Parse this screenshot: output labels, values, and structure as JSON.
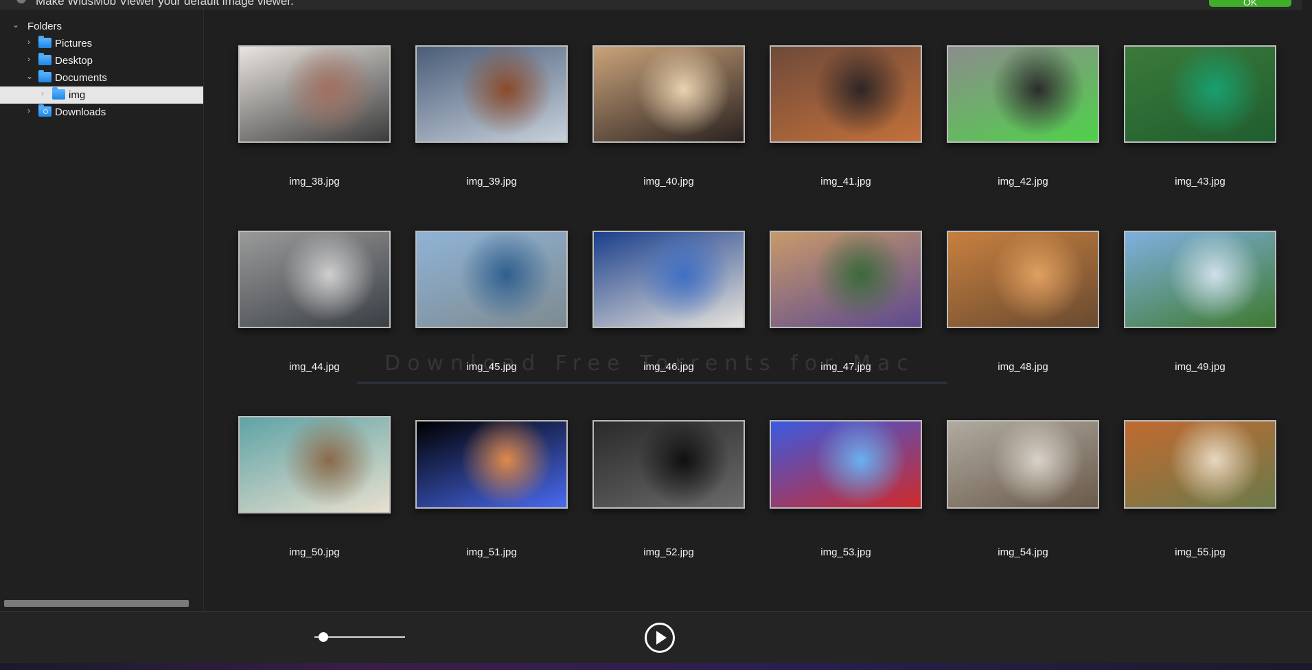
{
  "notification": {
    "message": "Make WidsMob Viewer your default image viewer.",
    "ok_label": "OK"
  },
  "sidebar": {
    "root_label": "Folders",
    "items": [
      {
        "label": "Pictures",
        "icon": "folder-icon"
      },
      {
        "label": "Desktop",
        "icon": "folder-icon"
      },
      {
        "label": "Documents",
        "icon": "folder-icon",
        "expanded": true
      },
      {
        "label": "img",
        "icon": "folder-icon",
        "selected": true
      },
      {
        "label": "Downloads",
        "icon": "downloads-folder-icon"
      }
    ]
  },
  "thumbnails": [
    {
      "name": "img_38.jpg",
      "colors": [
        "#e8e4df",
        "#3b3b3b",
        "#a07060"
      ]
    },
    {
      "name": "img_39.jpg",
      "colors": [
        "#4b5d78",
        "#c7d1dc",
        "#8a4a2a"
      ]
    },
    {
      "name": "img_40.jpg",
      "colors": [
        "#caa37a",
        "#2a2220",
        "#e9d2b0"
      ]
    },
    {
      "name": "img_41.jpg",
      "colors": [
        "#6f4a3a",
        "#c2703a",
        "#2d2525"
      ]
    },
    {
      "name": "img_42.jpg",
      "colors": [
        "#8c8c8c",
        "#4fd14a",
        "#2c2c2c"
      ]
    },
    {
      "name": "img_43.jpg",
      "colors": [
        "#3b7a3a",
        "#1f5e2f",
        "#18a070"
      ]
    },
    {
      "name": "img_44.jpg",
      "colors": [
        "#9a9a9a",
        "#3a3f45",
        "#cfcfcf"
      ]
    },
    {
      "name": "img_45.jpg",
      "colors": [
        "#8fb3d6",
        "#7e8a90",
        "#2f5f8e"
      ]
    },
    {
      "name": "img_46.jpg",
      "colors": [
        "#1b3f8c",
        "#e6e3dc",
        "#3f6fc4"
      ]
    },
    {
      "name": "img_47.jpg",
      "colors": [
        "#c89a6a",
        "#5e4a8f",
        "#3a6a3a"
      ]
    },
    {
      "name": "img_48.jpg",
      "colors": [
        "#c7803f",
        "#6a4a30",
        "#e0a060"
      ]
    },
    {
      "name": "img_49.jpg",
      "colors": [
        "#7fb0e0",
        "#3f7a2f",
        "#cfe0ea"
      ]
    },
    {
      "name": "img_50.jpg",
      "colors": [
        "#5fa3a6",
        "#e8e0cf",
        "#8a6a4a"
      ]
    },
    {
      "name": "img_51.jpg",
      "colors": [
        "#000000",
        "#4a6af0",
        "#e08a4a"
      ]
    },
    {
      "name": "img_52.jpg",
      "colors": [
        "#2a2a2a",
        "#6a6a6a",
        "#101010"
      ]
    },
    {
      "name": "img_53.jpg",
      "colors": [
        "#3a5ae0",
        "#d02a2a",
        "#6ab0f0"
      ]
    },
    {
      "name": "img_54.jpg",
      "colors": [
        "#b0aaa0",
        "#6a5a4a",
        "#d8d2c8"
      ]
    },
    {
      "name": "img_55.jpg",
      "colors": [
        "#c26a30",
        "#6a7a4a",
        "#e8d8c0"
      ]
    }
  ],
  "watermark": "Download Free Torrents for Mac",
  "toolbar": {
    "zoom_slider_value": 0.1,
    "play_icon": "play-icon"
  }
}
